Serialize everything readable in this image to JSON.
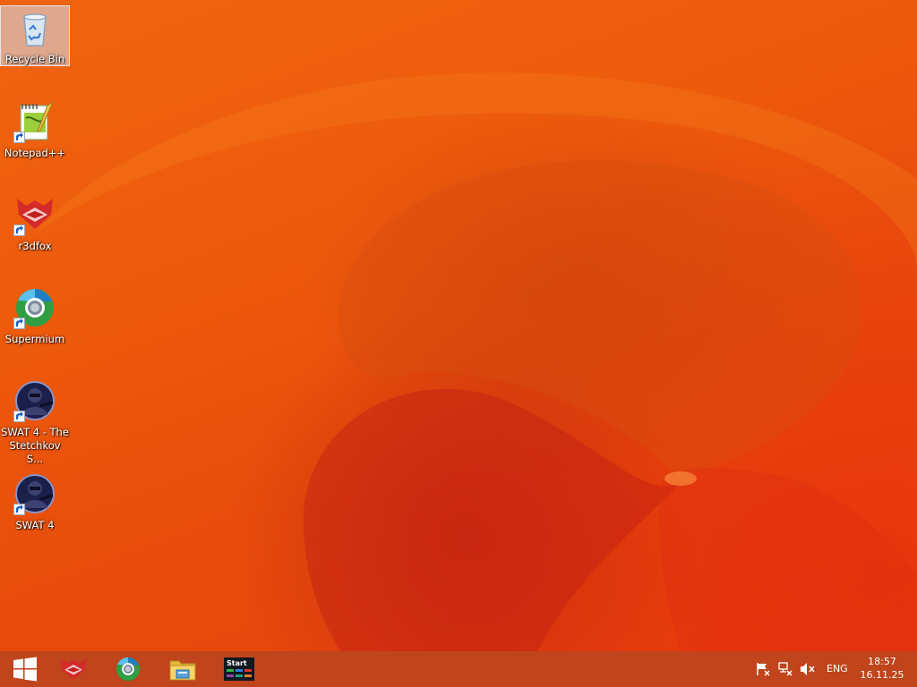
{
  "desktop": {
    "icons": [
      {
        "label": "Recycle Bin",
        "icon": "recycle-bin-icon"
      },
      {
        "label": "Notepad++",
        "icon": "notepad-plus-plus-icon"
      },
      {
        "label": "r3dfox",
        "icon": "r3dfox-icon"
      },
      {
        "label": "Supermium",
        "icon": "supermium-icon"
      },
      {
        "label": "SWAT 4 - The Stetchkov S...",
        "icon": "swat4-expansion-icon"
      },
      {
        "label": "SWAT 4",
        "icon": "swat4-icon"
      }
    ]
  },
  "taskbar": {
    "start": {
      "icon": "windows-start-icon"
    },
    "pinned": [
      {
        "icon": "r3dfox-icon"
      },
      {
        "icon": "supermium-icon"
      },
      {
        "icon": "file-explorer-icon"
      },
      {
        "icon": "start-menu-app-icon",
        "label": "Start"
      }
    ],
    "tray": {
      "icons": [
        "action-center-flag-icon",
        "network-icon",
        "volume-muted-icon"
      ],
      "language": "ENG",
      "time": "18:57",
      "date": "16.11.25"
    }
  },
  "colors": {
    "wallpaper": "#ee5a0c",
    "taskbar": "#c0441c",
    "selection": "#d2e1f5"
  }
}
